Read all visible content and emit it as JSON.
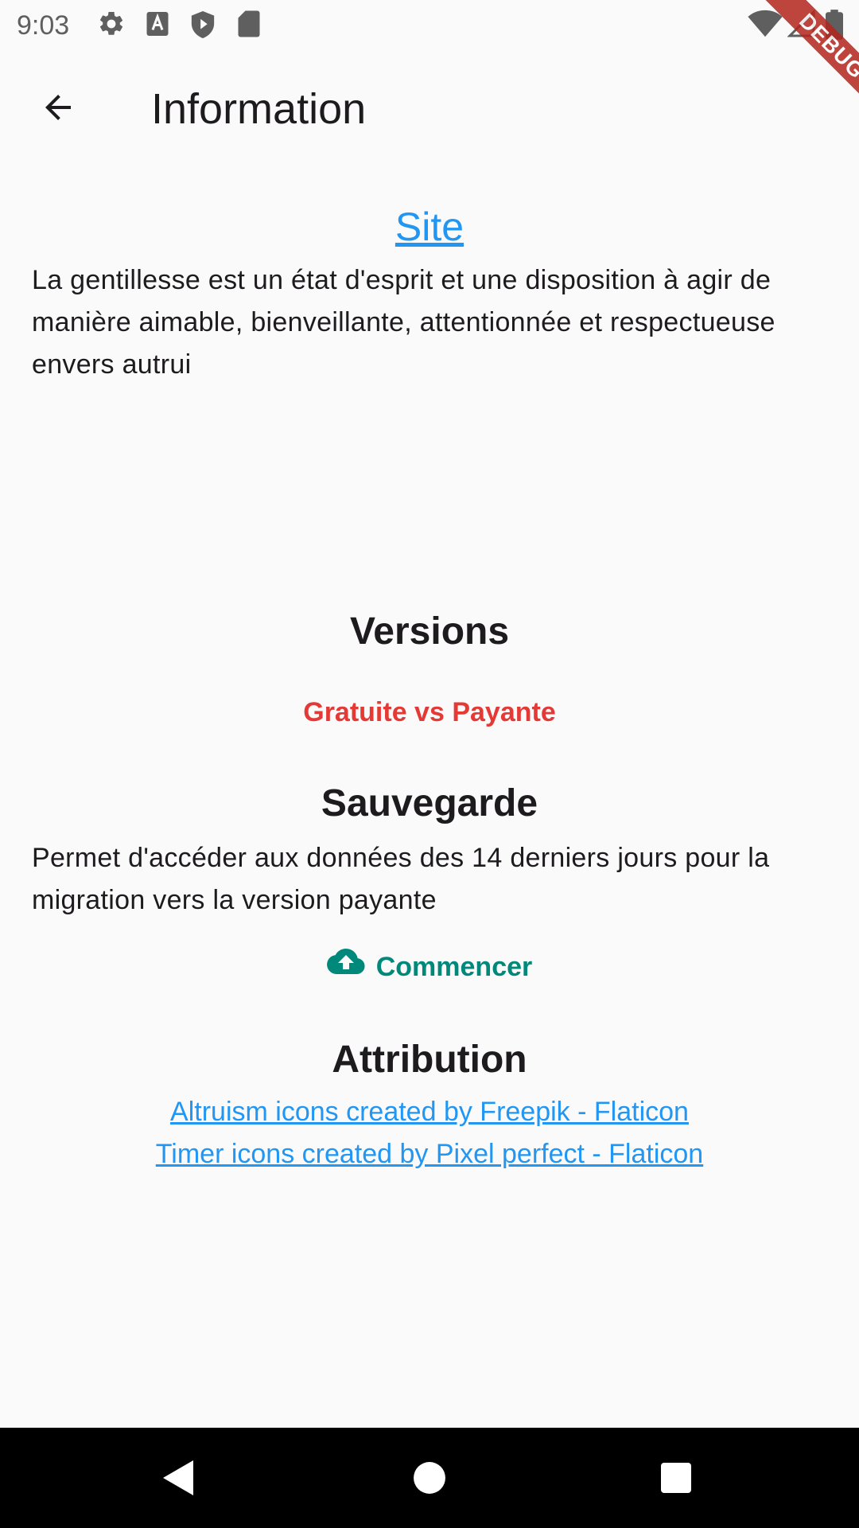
{
  "status_bar": {
    "time": "9:03",
    "icons": [
      "gear-icon",
      "accessibility-a-icon",
      "shield-play-icon",
      "sd-card-icon",
      "wifi-icon",
      "signal-icon",
      "battery-icon"
    ]
  },
  "app_bar": {
    "title": "Information",
    "back_icon": "arrow-back-icon"
  },
  "debug_banner": "DEBUG",
  "content": {
    "site_link": "Site",
    "site_description": "La gentillesse est un état d'esprit et une disposition à agir de manière aimable, bienveillante, attentionnée et respectueuse envers autrui",
    "versions_heading": "Versions",
    "versions_button": "Gratuite vs Payante",
    "backup_heading": "Sauvegarde",
    "backup_description": "Permet d'accéder aux données des 14 derniers jours pour la migration vers la version payante",
    "backup_button": "Commencer",
    "backup_button_icon": "cloud-upload-icon",
    "attribution_heading": "Attribution",
    "attribution_links": [
      "Altruism icons created by Freepik - Flaticon",
      "Timer icons created by Pixel perfect - Flaticon"
    ]
  },
  "colors": {
    "link": "#2196f3",
    "versions_button": "#e53935",
    "backup_button": "#00897b",
    "background": "#fafafa"
  },
  "nav_bar": {
    "icons": [
      "back-triangle-icon",
      "home-circle-icon",
      "recents-square-icon"
    ]
  }
}
